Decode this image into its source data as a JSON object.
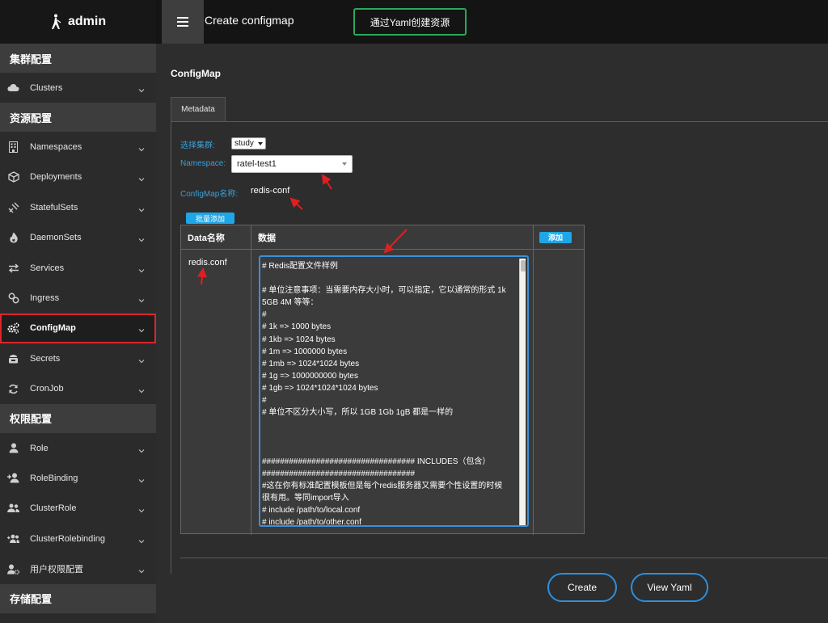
{
  "brand": {
    "name": "admin"
  },
  "topbar": {
    "title": "Create configmap",
    "yaml_button": "通过Yaml创建资源"
  },
  "sidebar": {
    "sections": [
      {
        "title": "集群配置",
        "items": [
          {
            "label": "Clusters",
            "icon": "cloud-icon"
          }
        ]
      },
      {
        "title": "资源配置",
        "items": [
          {
            "label": "Namespaces",
            "icon": "building-icon"
          },
          {
            "label": "Deployments",
            "icon": "cube-icon"
          },
          {
            "label": "StatefulSets",
            "icon": "satellite-icon"
          },
          {
            "label": "DaemonSets",
            "icon": "flame-icon"
          },
          {
            "label": "Services",
            "icon": "exchange-icon"
          },
          {
            "label": "Ingress",
            "icon": "link-icon"
          },
          {
            "label": "ConfigMap",
            "icon": "gears-icon",
            "active": true
          },
          {
            "label": "Secrets",
            "icon": "vault-icon"
          },
          {
            "label": "CronJob",
            "icon": "refresh-icon"
          }
        ]
      },
      {
        "title": "权限配置",
        "items": [
          {
            "label": "Role",
            "icon": "user-icon"
          },
          {
            "label": "RoleBinding",
            "icon": "user-plus-icon"
          },
          {
            "label": "ClusterRole",
            "icon": "users-icon"
          },
          {
            "label": "ClusterRolebinding",
            "icon": "users-plus-icon"
          },
          {
            "label": "用户权限配置",
            "icon": "user-gear-icon"
          }
        ]
      },
      {
        "title": "存储配置",
        "items": []
      }
    ]
  },
  "main": {
    "title": "ConfigMap",
    "tab": "Metadata",
    "form": {
      "cluster_label": "选择集群:",
      "cluster_value": "study",
      "namespace_label": "Namespace:",
      "namespace_value": "ratel-test1",
      "name_label": "ConfigMap名称:",
      "name_value": "redis-conf"
    },
    "batch_add_button": "批量添加",
    "table": {
      "headers": {
        "key": "Data名称",
        "value": "数据",
        "action": "添加"
      },
      "row": {
        "key": "redis.conf",
        "lines": [
          "# Redis配置文件样例",
          "",
          "# 单位注意事项：当需要内存大小时，可以指定，它以通常的形式 1k",
          "5GB 4M 等等：",
          "#",
          "# 1k => 1000 bytes",
          "# 1kb => 1024 bytes",
          "# 1m => 1000000 bytes",
          "# 1mb => 1024*1024 bytes",
          "# 1g => 1000000000 bytes",
          "# 1gb => 1024*1024*1024 bytes",
          "#",
          "# 单位不区分大小写，所以 1GB 1Gb 1gB 都是一样的",
          "",
          "",
          "",
          "################################## INCLUDES（包含）",
          "##################################",
          "#这在你有标准配置模板但是每个redis服务器又需要个性设置的时候",
          "很有用。等同import导入",
          "# include /path/to/local.conf",
          "# include /path/to/other.conf"
        ]
      }
    },
    "buttons": {
      "create": "Create",
      "view_yaml": "View Yaml"
    }
  },
  "colors": {
    "accent_blue": "#1fa6e6",
    "label_blue": "#3aa0d9",
    "highlight_red": "#d9262c",
    "yaml_green": "#2aa85b"
  }
}
